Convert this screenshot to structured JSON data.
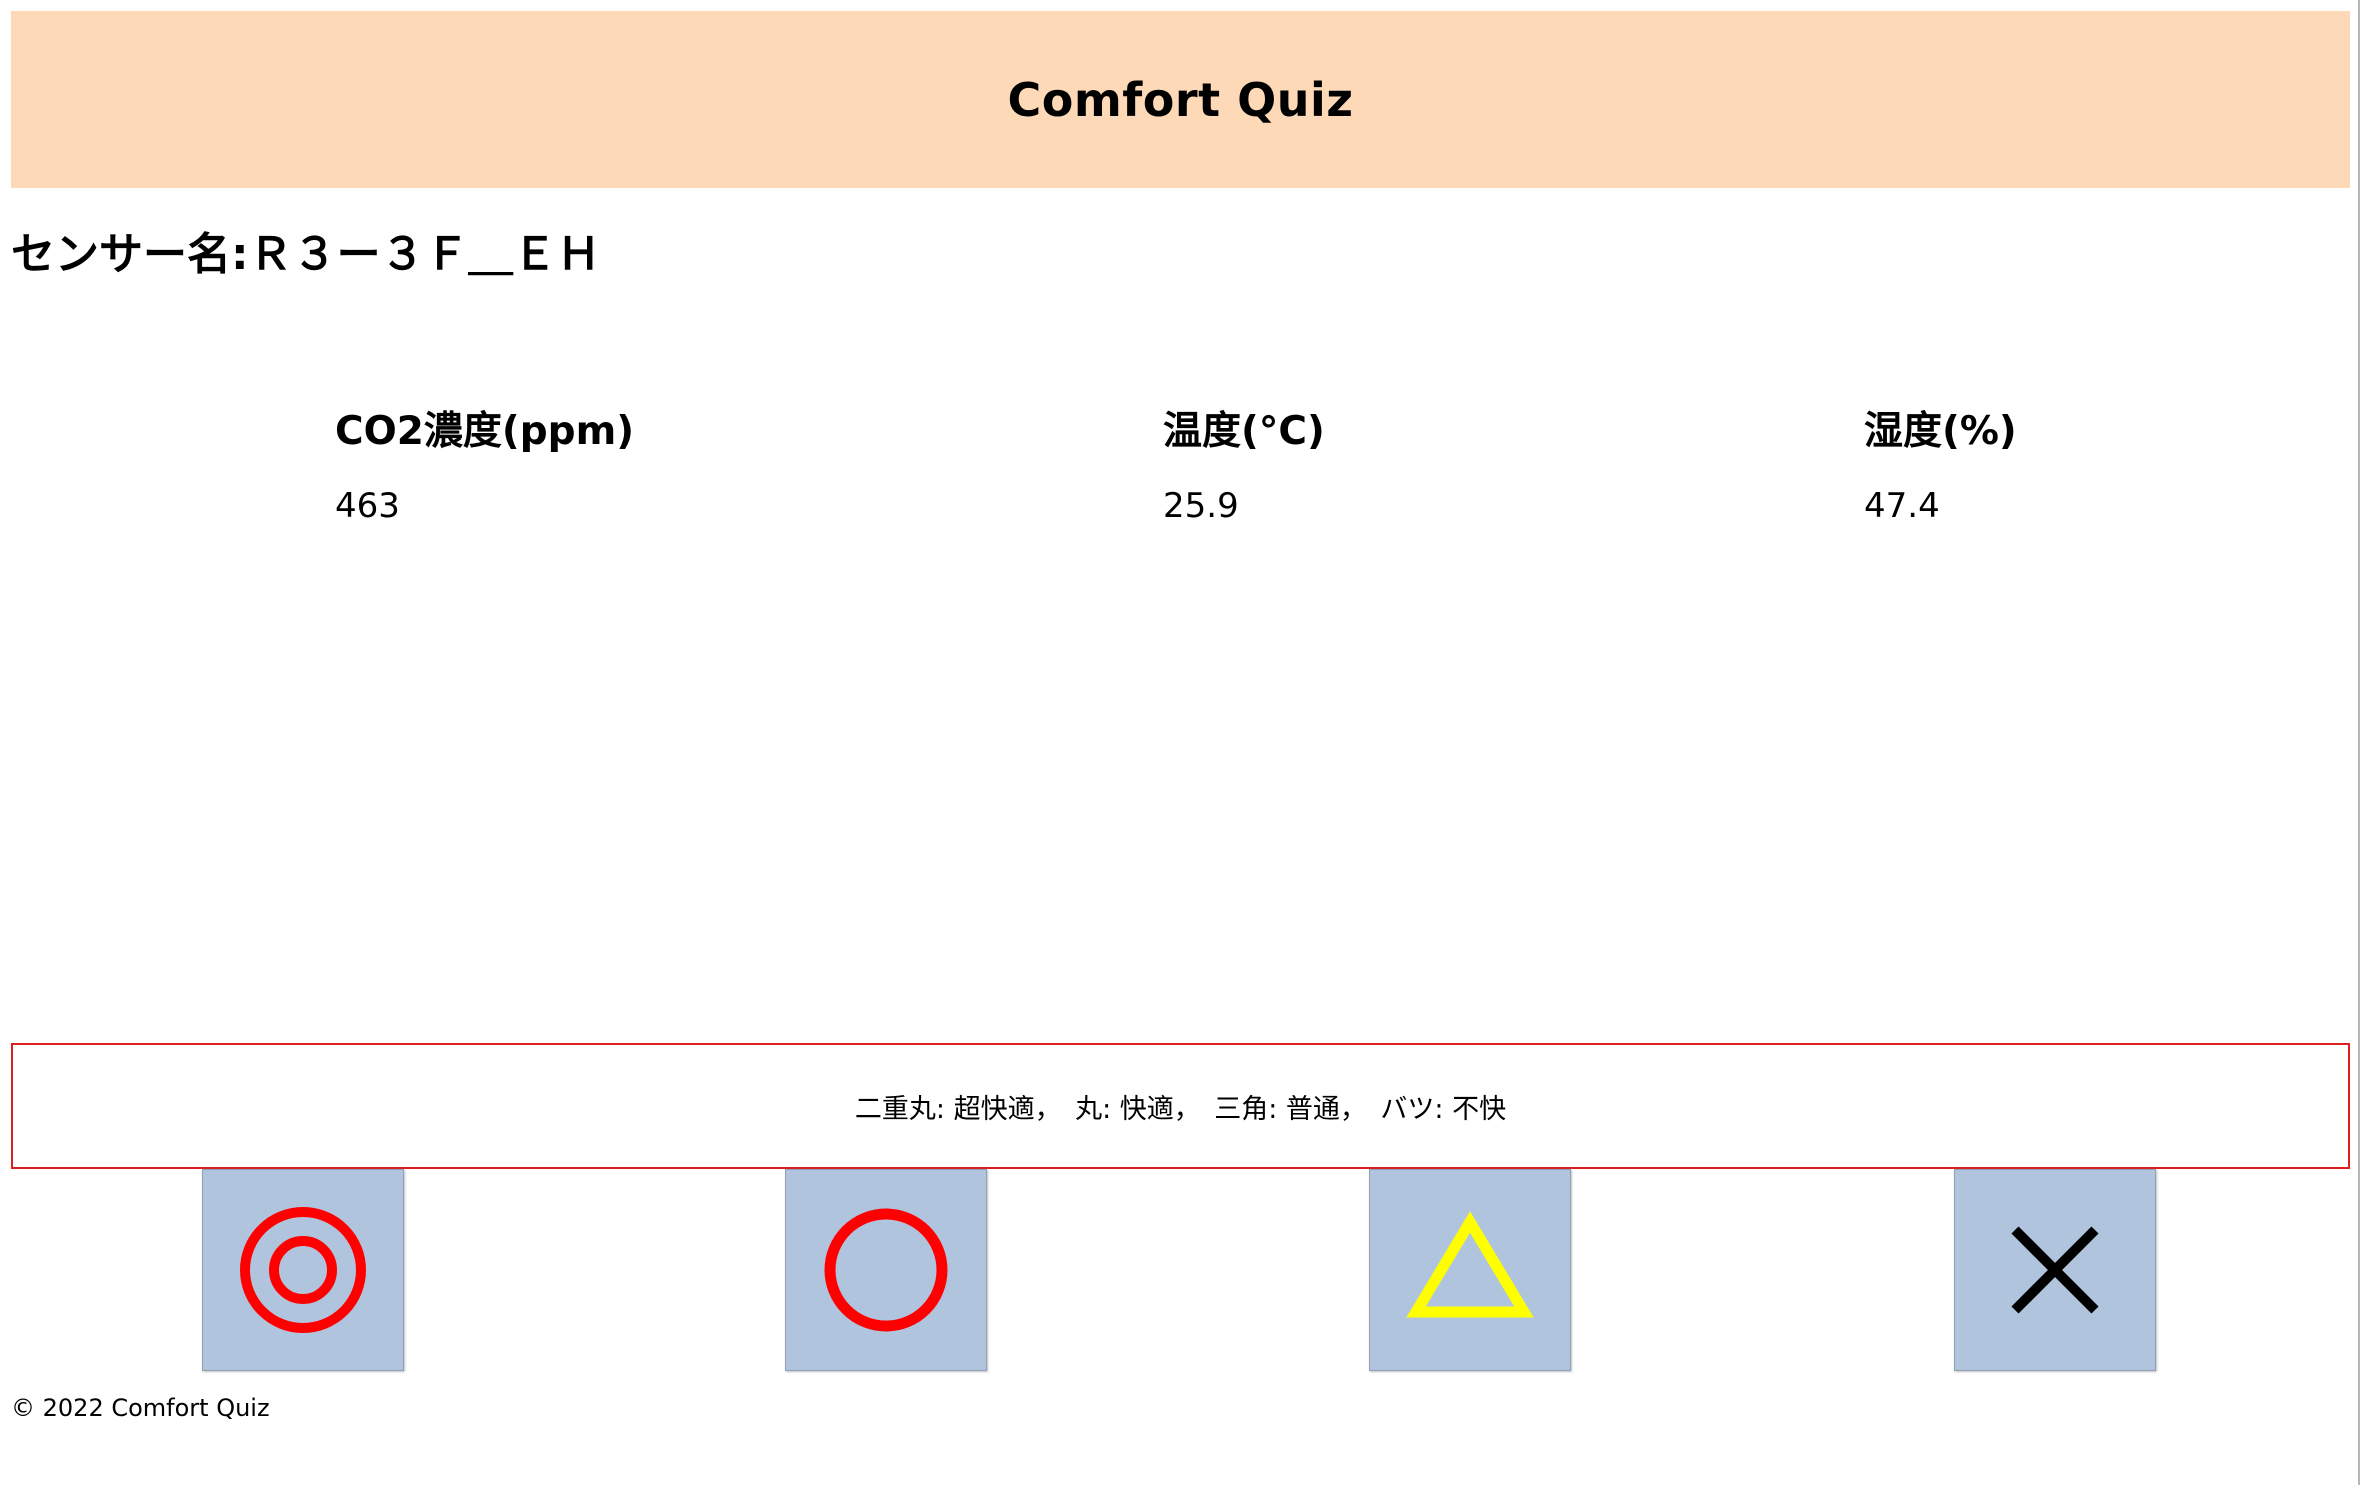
{
  "header": {
    "title": "Comfort Quiz"
  },
  "sensor": {
    "heading": "センサー名:Ｒ３ー３Ｆ＿ＥＨ"
  },
  "metrics": [
    {
      "label": "CO2濃度(ppm)",
      "value": "463"
    },
    {
      "label": "温度(°C)",
      "value": "25.9"
    },
    {
      "label": "湿度(%)",
      "value": "47.4"
    }
  ],
  "legend": {
    "text": "二重丸: 超快適，　丸: 快適，　三角: 普通，　バツ: 不快"
  },
  "buttons": [
    {
      "name": "double-circle",
      "icon": "double-circle-icon",
      "color": "#ff0000"
    },
    {
      "name": "circle",
      "icon": "circle-icon",
      "color": "#ff0000"
    },
    {
      "name": "triangle",
      "icon": "triangle-icon",
      "color": "#ffff00"
    },
    {
      "name": "cross",
      "icon": "cross-icon",
      "color": "#000000"
    }
  ],
  "footer": {
    "copyright": "© 2022 Comfort Quiz"
  },
  "colors": {
    "header_bg": "#fdd9b8",
    "button_bg": "#b0c4de",
    "legend_border": "#e02020"
  }
}
